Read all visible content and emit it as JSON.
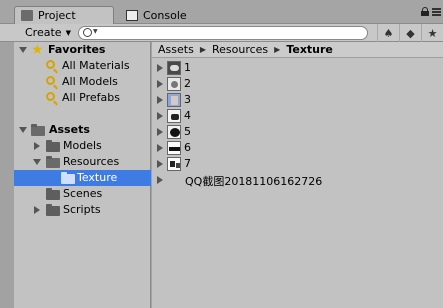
{
  "tabs": [
    {
      "label": "Project",
      "icon": "folder-icon",
      "active": true
    },
    {
      "label": "Console",
      "icon": "console-icon",
      "active": false
    }
  ],
  "toolbar": {
    "create_label": "Create",
    "search_placeholder": ""
  },
  "favorites": {
    "label": "Favorites",
    "items": [
      "All Materials",
      "All Models",
      "All Prefabs"
    ]
  },
  "assets": {
    "label": "Assets",
    "children": [
      {
        "label": "Models",
        "expanded": false
      },
      {
        "label": "Resources",
        "expanded": true
      },
      {
        "label": "Texture",
        "selected": true
      },
      {
        "label": "Scenes",
        "expanded": false
      },
      {
        "label": "Scripts",
        "expanded": false
      }
    ]
  },
  "breadcrumb": [
    "Assets",
    "Resources",
    "Texture"
  ],
  "files": [
    {
      "name": "1"
    },
    {
      "name": "2"
    },
    {
      "name": "3"
    },
    {
      "name": "4"
    },
    {
      "name": "5"
    },
    {
      "name": "6"
    },
    {
      "name": "7"
    },
    {
      "name": "QQ截图20181106162726"
    }
  ],
  "colors": {
    "selection": "#3e7ce4",
    "panel": "#c2c2c2",
    "star": "#e2b400"
  }
}
